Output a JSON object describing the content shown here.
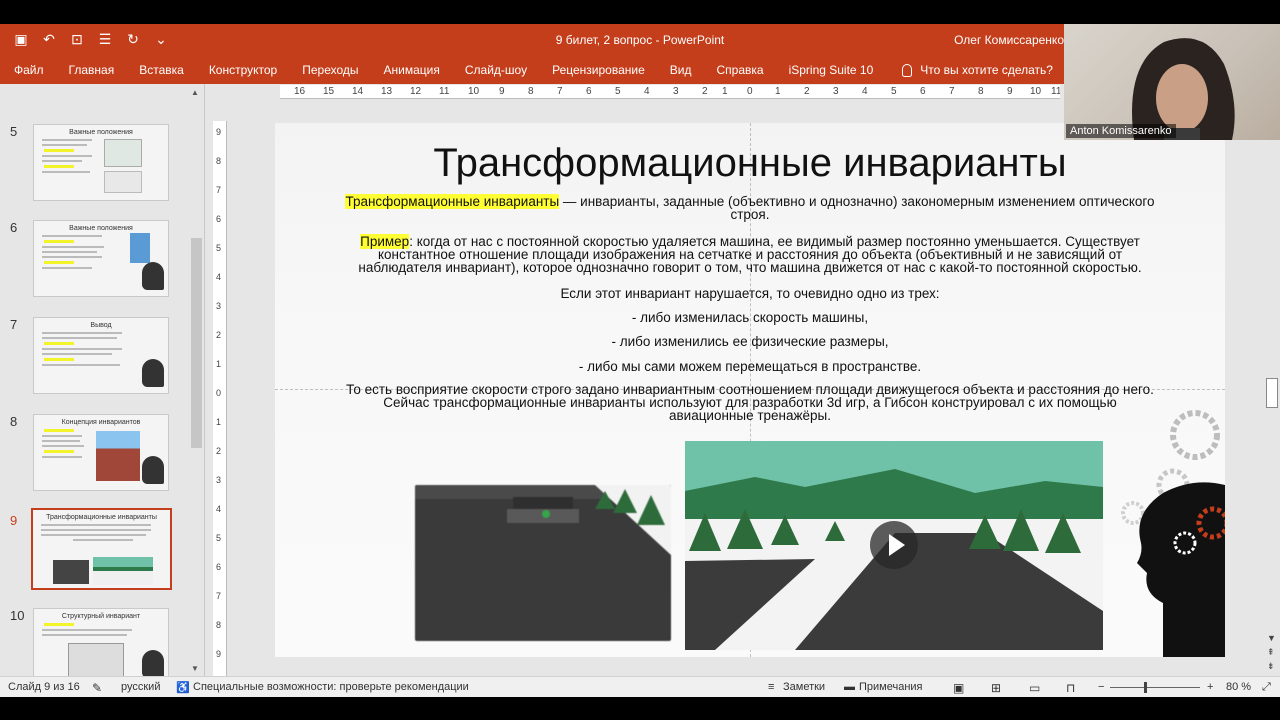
{
  "app": {
    "doc_title": "9 билет, 2 вопрос  -  PowerPoint",
    "user": "Олег Комиссаренко",
    "accent": "#c43e1c"
  },
  "ribbon": {
    "tabs": [
      "Файл",
      "Главная",
      "Вставка",
      "Конструктор",
      "Переходы",
      "Анимация",
      "Слайд-шоу",
      "Рецензирование",
      "Вид",
      "Справка",
      "iSpring Suite 10"
    ],
    "tell_me": "Что вы хотите сделать?"
  },
  "thumbnails": [
    {
      "num": "5",
      "title": "Важные положения"
    },
    {
      "num": "6",
      "title": "Важные положения"
    },
    {
      "num": "7",
      "title": "Вывод"
    },
    {
      "num": "8",
      "title": "Концепция инвариантов"
    },
    {
      "num": "9",
      "title": "Трансформационные инварианты"
    },
    {
      "num": "10",
      "title": "Структурный инвариант"
    }
  ],
  "ruler_h": [
    "16",
    "15",
    "14",
    "13",
    "12",
    "11",
    "10",
    "9",
    "8",
    "7",
    "6",
    "5",
    "4",
    "3",
    "2",
    "1",
    "0",
    "1",
    "2",
    "3",
    "4",
    "5",
    "6",
    "7",
    "8",
    "9",
    "10",
    "11"
  ],
  "ruler_v": [
    "9",
    "8",
    "7",
    "6",
    "5",
    "4",
    "3",
    "2",
    "1",
    "0",
    "1",
    "2",
    "3",
    "4",
    "5",
    "6",
    "7",
    "8",
    "9"
  ],
  "slide": {
    "title": "Трансформационные инварианты",
    "p1_hl": "Трансформационные инварианты",
    "p1_rest": " — инварианты, заданные (объективно и однозначно) закономерным изменением оптического",
    "p1_line2": "строя.",
    "p2_hl": "Пример",
    "p2_rest": ": когда от нас с постоянной скоростью удаляется машина, ее видимый размер постоянно уменьшается. Существует",
    "p2_line2": "константное отношение площади изображения на сетчатке и расстояния до объекта (объективный и не зависящий от",
    "p2_line3": "наблюдателя инвариант), которое однозначно говорит о том, что машина движется от нас с какой-то постоянной скоростью.",
    "p3": "Если этот инвариант нарушается, то очевидно одно из трех:",
    "b1": "- либо изменилась скорость машины,",
    "b2": "- либо изменились ее физические размеры,",
    "b3": "- либо мы сами можем перемещаться в пространстве.",
    "p4_line1": "То есть восприятие скорости строго задано инвариантным соотношением площади движущегося объекта и расстояния до него.",
    "p4_line2": "Сейчас трансформационные инварианты используют для разработки 3d игр, а Гибсон конструировал с их помощью",
    "p4_line3": "авиационные тренажёры."
  },
  "webcam": {
    "name": "Anton Komissarenko"
  },
  "status": {
    "slide": "Слайд 9 из 16",
    "lang": "русский",
    "access": "Специальные возможности: проверьте рекомендации",
    "notes": "Заметки",
    "comments": "Примечания",
    "zoom": "80 %"
  }
}
